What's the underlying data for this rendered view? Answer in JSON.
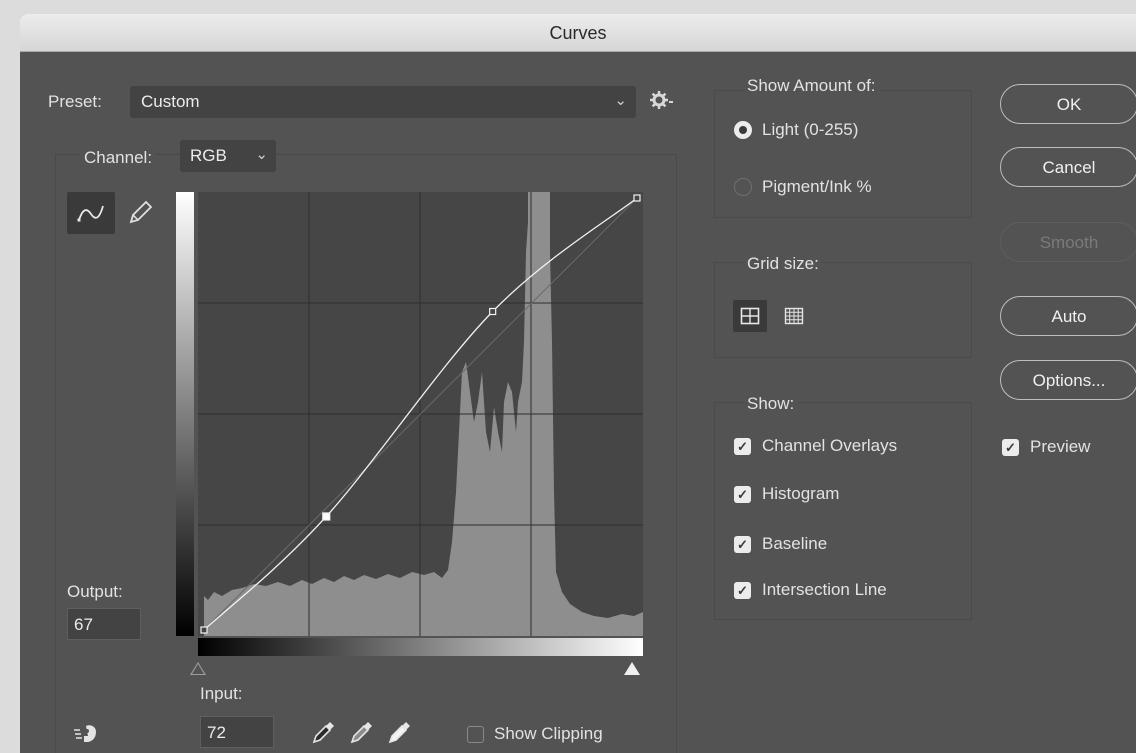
{
  "window": {
    "title": "Curves"
  },
  "preset": {
    "label": "Preset:",
    "value": "Custom"
  },
  "channel": {
    "label": "Channel:",
    "value": "RGB"
  },
  "output": {
    "label": "Output:",
    "value": "67"
  },
  "input": {
    "label": "Input:",
    "value": "72"
  },
  "show_clipping": {
    "label": "Show Clipping",
    "checked": false
  },
  "show_amount": {
    "title": "Show Amount of:",
    "options": [
      {
        "label": "Light  (0-255)",
        "selected": true
      },
      {
        "label": "Pigment/Ink %",
        "selected": false
      }
    ]
  },
  "grid_size": {
    "title": "Grid size:",
    "selected": "simple-grid"
  },
  "show": {
    "title": "Show:",
    "items": [
      {
        "label": "Channel Overlays",
        "checked": true
      },
      {
        "label": "Histogram",
        "checked": true
      },
      {
        "label": "Baseline",
        "checked": true
      },
      {
        "label": "Intersection Line",
        "checked": true
      }
    ]
  },
  "buttons": {
    "ok": "OK",
    "cancel": "Cancel",
    "smooth": "Smooth",
    "auto": "Auto",
    "options": "Options..."
  },
  "preview": {
    "label": "Preview",
    "checked": true
  },
  "curve": {
    "points": [
      {
        "input": 0,
        "output": 0
      },
      {
        "input": 72,
        "output": 67
      },
      {
        "input": 170,
        "output": 188
      },
      {
        "input": 255,
        "output": 255
      }
    ]
  },
  "icons": {
    "curve_tool": "curve-icon",
    "pencil_tool": "pencil-icon",
    "gear": "gear-icon",
    "hand_tool": "on-image-adjust-icon",
    "black_point": "black-eyedropper-icon",
    "gray_point": "gray-eyedropper-icon",
    "white_point": "white-eyedropper-icon"
  }
}
